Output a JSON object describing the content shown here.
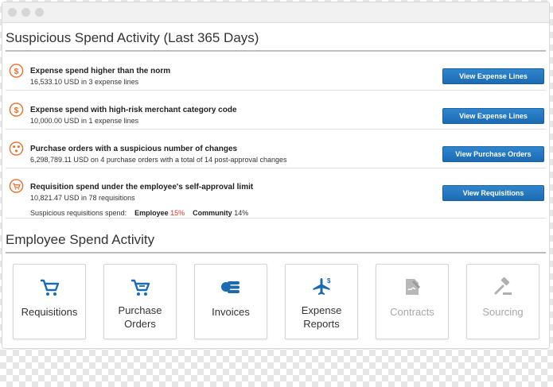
{
  "suspicious": {
    "title": "Suspicious Spend Activity (Last 365 Days)",
    "alerts": [
      {
        "title": "Expense spend higher than the norm",
        "detail": "16,533.10 USD in 3 expense lines",
        "button": "View Expense Lines"
      },
      {
        "title": "Expense spend with high-risk merchant category code",
        "detail": "10,000.00 USD in 1 expense lines",
        "button": "View Expense Lines"
      },
      {
        "title": "Purchase orders with a suspicious number of changes",
        "detail": "6,298,789.11 USD on 4 purchase orders with a total of 14 post-approval changes",
        "button": "View Purchase Orders"
      },
      {
        "title": "Requisition spend under the employee's self-approval limit",
        "detail": "10,821.47 USD in 78 requisitions",
        "button": "View Requisitions"
      }
    ],
    "requisition_spend": {
      "label": "Suspicious requisitions spend:",
      "employee_label": "Employee",
      "employee_pct": "15%",
      "community_label": "Community",
      "community_pct": "14%"
    }
  },
  "employee": {
    "title": "Employee Spend Activity",
    "tiles": [
      {
        "line1": "Requisitions",
        "line2": ""
      },
      {
        "line1": "Purchase",
        "line2": "Orders"
      },
      {
        "line1": "Invoices",
        "line2": ""
      },
      {
        "line1": "Expense",
        "line2": "Reports"
      },
      {
        "line1": "Contracts",
        "line2": ""
      },
      {
        "line1": "Sourcing",
        "line2": ""
      }
    ]
  },
  "colors": {
    "accent": "#1c6bb2",
    "alert_orange": "#e8702a",
    "disabled": "#a8a8a8",
    "danger": "#e0352b"
  }
}
